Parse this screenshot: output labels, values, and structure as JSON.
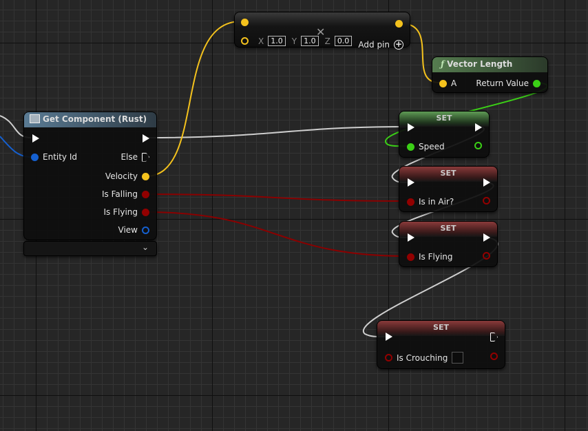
{
  "colors": {
    "exec": "#ffffff",
    "vector": "#f4c21d",
    "float": "#3bd016",
    "bool": "#920000",
    "entity": "#1560d0",
    "object": "#1560d0"
  },
  "make_vector": {
    "x_label": "X",
    "x": "1.0",
    "y_label": "Y",
    "y": "1.0",
    "z_label": "Z",
    "z": "0.0",
    "add_pin": "Add pin",
    "add_icon": "plus-circle-icon",
    "remove_icon": "close-icon"
  },
  "vector_length": {
    "title": "Vector Length",
    "icon": "function-icon",
    "input": "A",
    "output": "Return Value"
  },
  "get_component": {
    "title": "Get Component (Rust)",
    "icon": "component-icon",
    "entity_id": "Entity Id",
    "else": "Else",
    "velocity": "Velocity",
    "is_falling": "Is Falling",
    "is_flying": "Is Flying",
    "view": "View"
  },
  "set_nodes": [
    {
      "title": "SET",
      "var": "Speed"
    },
    {
      "title": "SET",
      "var": "Is in Air?"
    },
    {
      "title": "SET",
      "var": "Is Flying"
    },
    {
      "title": "SET",
      "var": "Is Crouching",
      "checked": false
    }
  ]
}
